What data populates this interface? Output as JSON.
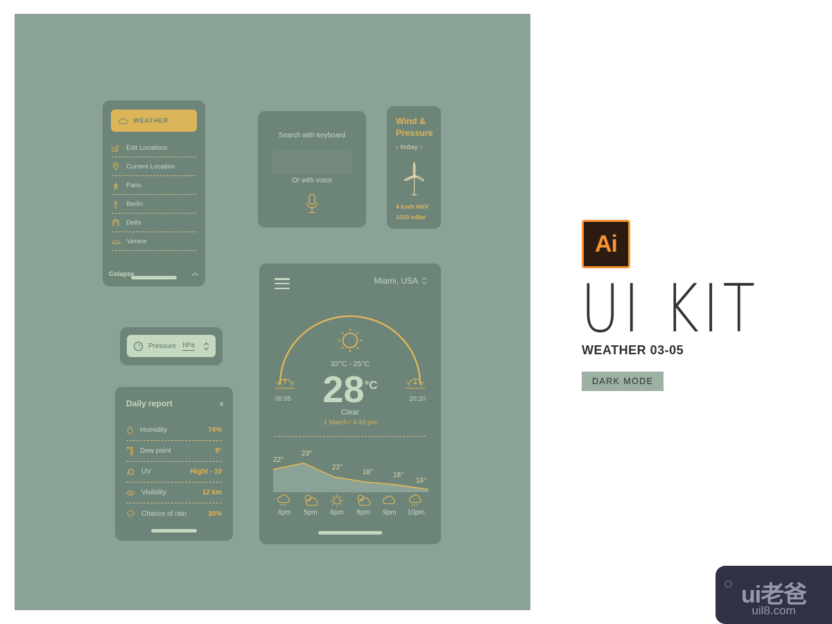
{
  "canvas": {
    "bg": "#8ba296",
    "card_bg": "#6d8478",
    "accent": "#ddb559",
    "text_light": "#c4d9bf"
  },
  "locations_card": {
    "active_label": "WEATHER",
    "active_icon": "cloud-icon",
    "items": [
      {
        "label": "Edit Locations",
        "icon": "edit-pencil-icon"
      },
      {
        "label": "Current Location",
        "icon": "map-pin-icon"
      },
      {
        "label": "Paris",
        "icon": "eiffel-tower-icon"
      },
      {
        "label": "Berlin",
        "icon": "tv-tower-icon"
      },
      {
        "label": "Delhi",
        "icon": "india-gate-icon"
      },
      {
        "label": "Venice",
        "icon": "rialto-bridge-icon"
      }
    ],
    "collapse_label": "Colapse",
    "collapse_icon": "chevron-up-icon"
  },
  "search_card": {
    "keyboard_label": "Search with keyboard",
    "input_value": "",
    "input_placeholder": "",
    "voice_label": "Or with voice",
    "voice_icon": "microphone-icon"
  },
  "wind_card": {
    "title": "Wind & Pressure",
    "period": "‹ today ›",
    "prev_icon": "chevron-left-icon",
    "next_icon": "chevron-right-icon",
    "icon": "wind-turbine-icon",
    "wind": "4 km/h NNV",
    "pressure": "1010 mBar"
  },
  "pressure_card": {
    "label": "Pressure",
    "icon": "gauge-icon",
    "unit": "hPa",
    "stepper_icon": "updown-chevrons-icon"
  },
  "daily_report": {
    "title": "Daily report",
    "close_label": "x",
    "rows": [
      {
        "label": "Humidity",
        "value": "74%",
        "icon": "droplet-icon"
      },
      {
        "label": "Dew point",
        "value": "8°",
        "icon": "thermometer-icon"
      },
      {
        "label": "UV",
        "value": "Hight - 10",
        "icon": "uv-sun-icon"
      },
      {
        "label": "Visibility",
        "value": "12 km",
        "icon": "eye-icon"
      },
      {
        "label": "Chance of rain",
        "value": "30%",
        "icon": "rain-cloud-icon"
      }
    ]
  },
  "main_card": {
    "menu_icon": "hamburger-menu-icon",
    "city": "Miami, USA",
    "city_stepper_icon": "updown-chevrons-icon",
    "condition_icon": "sun-icon",
    "temp_range": "32°C - 25°C",
    "temperature": "28",
    "temp_unit": "°C",
    "condition": "Clear",
    "datetime": "1 March /  4:33 pm",
    "sunrise_time": "06:05",
    "sunset_time": "20:20",
    "sunrise_icon": "sunrise-icon",
    "sunset_icon": "sunset-icon"
  },
  "chart_data": {
    "type": "area",
    "title": "",
    "xlabel": "",
    "ylabel": "",
    "categories": [
      "4pm",
      "5pm",
      "6pm",
      "8pm",
      "9pm",
      "10pm"
    ],
    "values": [
      22,
      23,
      22,
      18,
      18,
      16
    ],
    "labels": [
      "22°",
      "23°",
      "22°",
      "18°",
      "18°",
      "16°"
    ],
    "icons": [
      "rain-cloud-icon",
      "sun-cloud-icon",
      "sun-icon",
      "sun-cloud-icon",
      "cloud-icon",
      "rain-cloud-icon"
    ],
    "ylim": [
      14,
      25
    ],
    "grid": false,
    "legend": "none",
    "line_color": "#ddb559",
    "fill_color": "#8ba296"
  },
  "branding": {
    "badge_text": "Ai",
    "badge_name": "adobe-illustrator-icon",
    "title": "UI KIT",
    "subtitle": "WEATHER 03-05",
    "mode_button": "DARK MODE"
  },
  "watermark": {
    "logo": "ui老爸",
    "url": "uil8.com"
  }
}
